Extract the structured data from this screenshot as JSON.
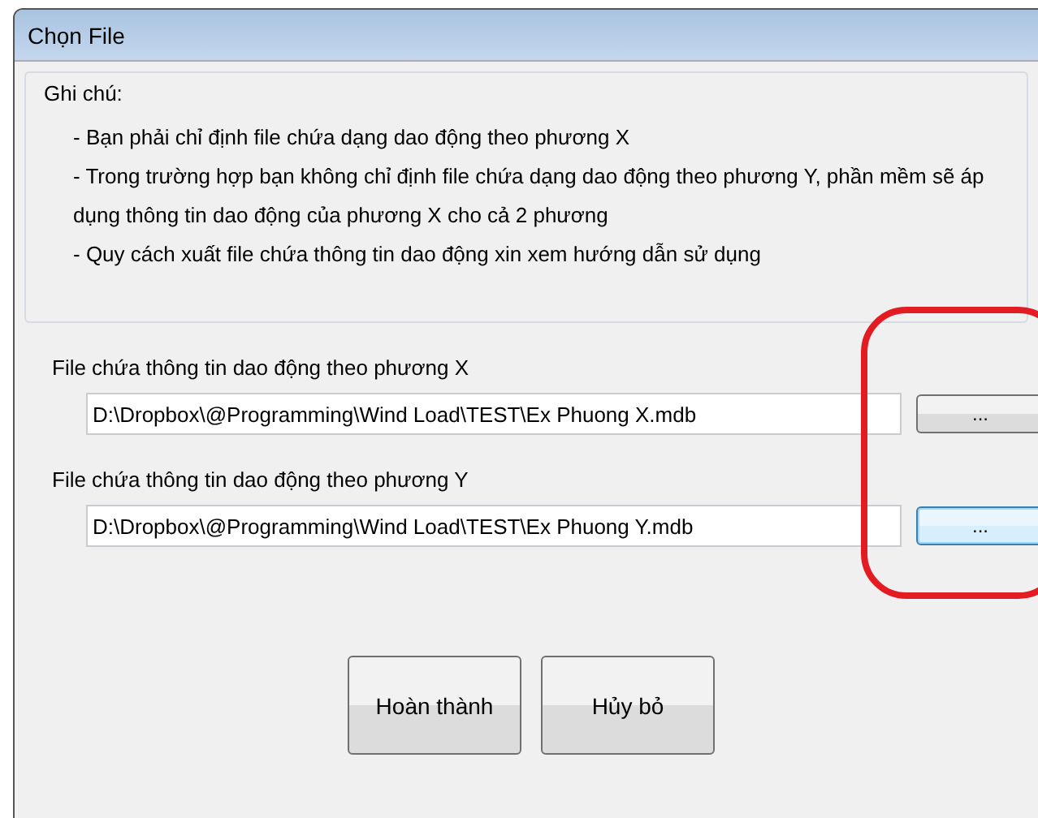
{
  "window": {
    "title": "Chọn File"
  },
  "notes": {
    "title": "Ghi chú:",
    "lines": [
      "- Bạn phải chỉ định file chứa dạng dao động theo phương X",
      "- Trong trường hợp bạn không chỉ định file chứa dạng dao động theo phương Y, phần mềm sẽ áp dụng thông tin dao động của phương X cho cả 2 phương",
      "- Quy cách xuất file chứa thông tin dao động xin xem hướng dẫn sử dụng"
    ]
  },
  "files": [
    {
      "label": "File chứa thông tin dao động theo phương X",
      "value": "D:\\Dropbox\\@Programming\\Wind Load\\TEST\\Ex Phuong X.mdb",
      "browse": "...",
      "focused": false
    },
    {
      "label": "File chứa thông tin dao động theo phương Y",
      "value": "D:\\Dropbox\\@Programming\\Wind Load\\TEST\\Ex Phuong Y.mdb",
      "browse": "...",
      "focused": true
    }
  ],
  "buttons": [
    "Hoàn thành",
    "Hủy bỏ"
  ]
}
